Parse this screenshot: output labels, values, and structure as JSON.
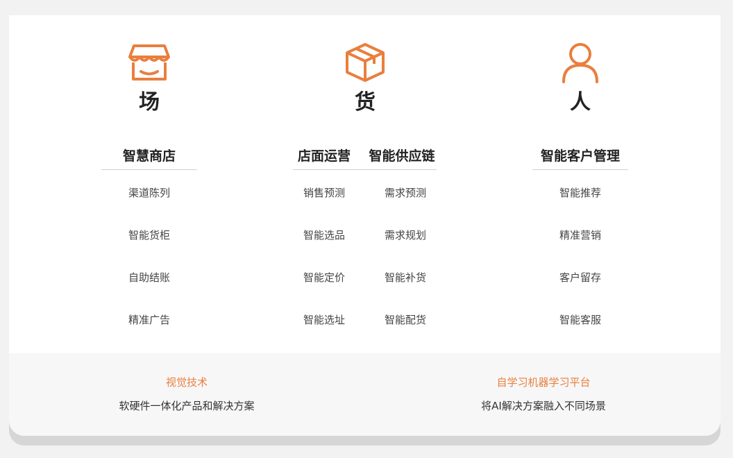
{
  "colors": {
    "accent": "#e97f3e",
    "text": "#222222",
    "muted": "#444444",
    "panel": "#f7f7f7"
  },
  "pillars": [
    {
      "title": "场",
      "icon": "store-icon"
    },
    {
      "title": "货",
      "icon": "package-icon"
    },
    {
      "title": "人",
      "icon": "person-icon"
    }
  ],
  "categories": {
    "smart_store": {
      "label": "智慧商店",
      "items": [
        "渠道陈列",
        "智能货柜",
        "自助结账",
        "精准广告"
      ]
    },
    "store_ops": {
      "label": "店面运营",
      "items": [
        "销售预测",
        "智能选品",
        "智能定价",
        "智能选址"
      ]
    },
    "supply_chain": {
      "label": "智能供应链",
      "items": [
        "需求预测",
        "需求规划",
        "智能补货",
        "智能配货"
      ]
    },
    "crm": {
      "label": "智能客户管理",
      "items": [
        "智能推荐",
        "精准营销",
        "客户留存",
        "智能客服"
      ]
    }
  },
  "technologies": [
    {
      "title": "视觉技术",
      "description": "软硬件一体化产品和解决方案"
    },
    {
      "title": "自学习机器学习平台",
      "description": "将AI解决方案融入不同场景"
    }
  ]
}
